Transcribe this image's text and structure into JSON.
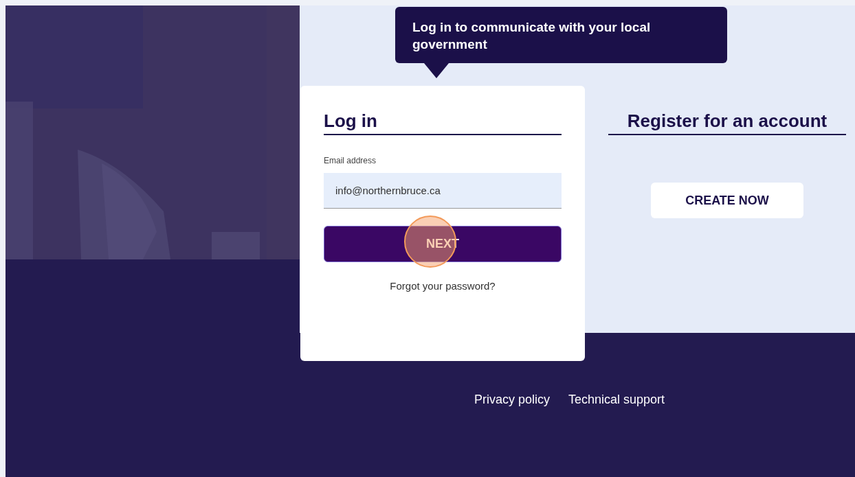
{
  "tooltip": {
    "text": "Log in to communicate with your local government"
  },
  "login": {
    "title": "Log in",
    "email": {
      "label": "Email address",
      "value": "info@northernbruce.ca"
    },
    "next_button": "NEXT",
    "click_marker": true,
    "forgot_link": "Forgot your password?"
  },
  "register": {
    "title": "Register for an account",
    "create_button": "CREATE NOW"
  },
  "footer_links": [
    "Privacy policy",
    "Technical support"
  ]
}
